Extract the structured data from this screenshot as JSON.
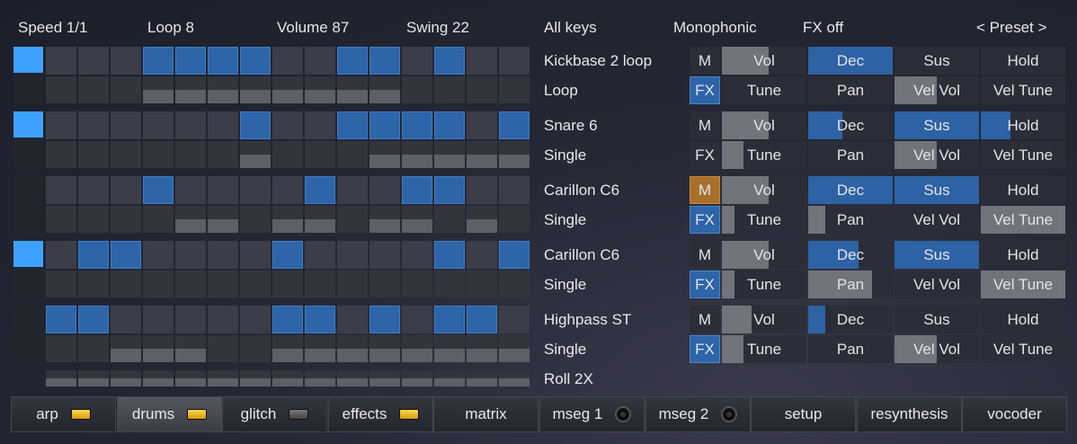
{
  "header": {
    "speed": "Speed 1/1",
    "loop": "Loop 8",
    "volume": "Volume 87",
    "swing": "Swing 22",
    "keys": "All keys",
    "mono": "Monophonic",
    "fx": "FX off",
    "preset": "< Preset >"
  },
  "tracks": [
    {
      "name": "Kickbase 2 loop",
      "mode": "Loop",
      "led": true,
      "steps": [
        0,
        0,
        0,
        1,
        1,
        1,
        1,
        0,
        0,
        1,
        1,
        0,
        1,
        0,
        0
      ],
      "vel": [
        0,
        0,
        0,
        0.5,
        0.5,
        0.5,
        0.5,
        0.5,
        0.5,
        0.5,
        0.5,
        0,
        0,
        0,
        0
      ]
    },
    {
      "name": "Snare 6",
      "mode": "Single",
      "led": true,
      "steps": [
        0,
        0,
        0,
        0,
        0,
        0,
        1,
        0,
        0,
        1,
        1,
        1,
        1,
        0,
        1
      ],
      "vel": [
        0,
        0,
        0,
        0,
        0,
        0,
        0.5,
        0,
        0,
        0,
        0.5,
        0.5,
        0.5,
        0.5,
        0.5
      ]
    },
    {
      "name": "Carillon C6",
      "mode": "Single",
      "led": false,
      "steps": [
        0,
        0,
        0,
        1,
        0,
        0,
        0,
        0,
        1,
        0,
        0,
        1,
        1,
        0,
        0
      ],
      "vel": [
        0,
        0,
        0,
        0,
        0.5,
        0.5,
        0,
        0.5,
        0.5,
        0,
        0.5,
        0.5,
        0,
        0.5,
        0
      ]
    },
    {
      "name": "Carillon C6",
      "mode": "Single",
      "led": true,
      "steps": [
        0,
        1,
        1,
        0,
        0,
        0,
        0,
        1,
        0,
        0,
        0,
        0,
        1,
        0,
        1
      ],
      "vel": [
        0,
        0,
        0,
        0,
        0,
        0,
        0,
        0,
        0,
        0,
        0,
        0,
        0,
        0,
        0
      ]
    },
    {
      "name": "Highpass ST",
      "mode": "Single",
      "led": false,
      "steps": [
        1,
        1,
        0,
        0,
        0,
        0,
        0,
        1,
        1,
        0,
        1,
        0,
        1,
        1,
        0
      ],
      "vel": [
        0,
        0,
        0.5,
        0.5,
        0.5,
        0,
        0,
        0.5,
        0.5,
        0.5,
        0.5,
        0.5,
        0.5,
        0.5,
        0.5
      ]
    }
  ],
  "roll": {
    "name": "Roll 2X",
    "vel": [
      0.5,
      0.5,
      0.5,
      0.5,
      0.5,
      0.5,
      0.5,
      0.5,
      0.5,
      0.5,
      0.5,
      0.5,
      0.5,
      0.5,
      0.5
    ]
  },
  "controls": [
    {
      "m": "M",
      "m_active": false,
      "vol": "Vol",
      "vol_level": 0.55,
      "dec": "Dec",
      "dec_level": 1.0,
      "sus": "Sus",
      "sus_level": 0,
      "hold": "Hold",
      "hold_level": 0,
      "fx": "FX",
      "fx_active": true,
      "tune": "Tune",
      "tune_level": 0,
      "pan": "Pan",
      "pan_level": 0,
      "velvol": "Vel Vol",
      "velvol_level": 0.5,
      "veltune": "Vel Tune",
      "veltune_level": 0
    },
    {
      "m": "M",
      "m_active": false,
      "vol": "Vol",
      "vol_level": 0.55,
      "dec": "Dec",
      "dec_level": 0.4,
      "sus": "Sus",
      "sus_level": 1.0,
      "hold": "Hold",
      "hold_level": 0.35,
      "fx": "FX",
      "fx_active": false,
      "tune": "Tune",
      "tune_level": 0.25,
      "pan": "Pan",
      "pan_level": 0,
      "velvol": "Vel Vol",
      "velvol_level": 0.5,
      "veltune": "Vel Tune",
      "veltune_level": 0
    },
    {
      "m": "M",
      "m_active": true,
      "vol": "Vol",
      "vol_level": 0.55,
      "dec": "Dec",
      "dec_level": 1.0,
      "sus": "Sus",
      "sus_level": 1.0,
      "hold": "Hold",
      "hold_level": 0,
      "fx": "FX",
      "fx_active": true,
      "tune": "Tune",
      "tune_level": 0.15,
      "pan": "Pan",
      "pan_level": 0.2,
      "velvol": "Vel Vol",
      "velvol_level": 0,
      "veltune": "Vel Tune",
      "veltune_level": 1.0
    },
    {
      "m": "M",
      "m_active": false,
      "vol": "Vol",
      "vol_level": 0.55,
      "dec": "Dec",
      "dec_level": 0.6,
      "sus": "Sus",
      "sus_level": 1.0,
      "hold": "Hold",
      "hold_level": 0,
      "fx": "FX",
      "fx_active": true,
      "tune": "Tune",
      "tune_level": 0.15,
      "pan": "Pan",
      "pan_level": 0.75,
      "velvol": "Vel Vol",
      "velvol_level": 0,
      "veltune": "Vel Tune",
      "veltune_level": 1.0
    },
    {
      "m": "M",
      "m_active": false,
      "vol": "Vol",
      "vol_level": 0.35,
      "dec": "Dec",
      "dec_level": 0.2,
      "sus": "Sus",
      "sus_level": 0,
      "hold": "Hold",
      "hold_level": 0,
      "fx": "FX",
      "fx_active": true,
      "tune": "Tune",
      "tune_level": 0.25,
      "pan": "Pan",
      "pan_level": 0,
      "velvol": "Vel Vol",
      "velvol_level": 0.5,
      "veltune": "Vel Tune",
      "veltune_level": 0
    }
  ],
  "tabs": [
    {
      "label": "arp",
      "indicator": "led-on"
    },
    {
      "label": "drums",
      "indicator": "led-on",
      "active": true
    },
    {
      "label": "glitch",
      "indicator": "led-off"
    },
    {
      "label": "effects",
      "indicator": "led-on"
    },
    {
      "label": "matrix",
      "indicator": "none"
    },
    {
      "label": "mseg 1",
      "indicator": "knob"
    },
    {
      "label": "mseg 2",
      "indicator": "knob"
    },
    {
      "label": "setup",
      "indicator": "none"
    },
    {
      "label": "resynthesis",
      "indicator": "none"
    },
    {
      "label": "vocoder",
      "indicator": "none"
    }
  ]
}
